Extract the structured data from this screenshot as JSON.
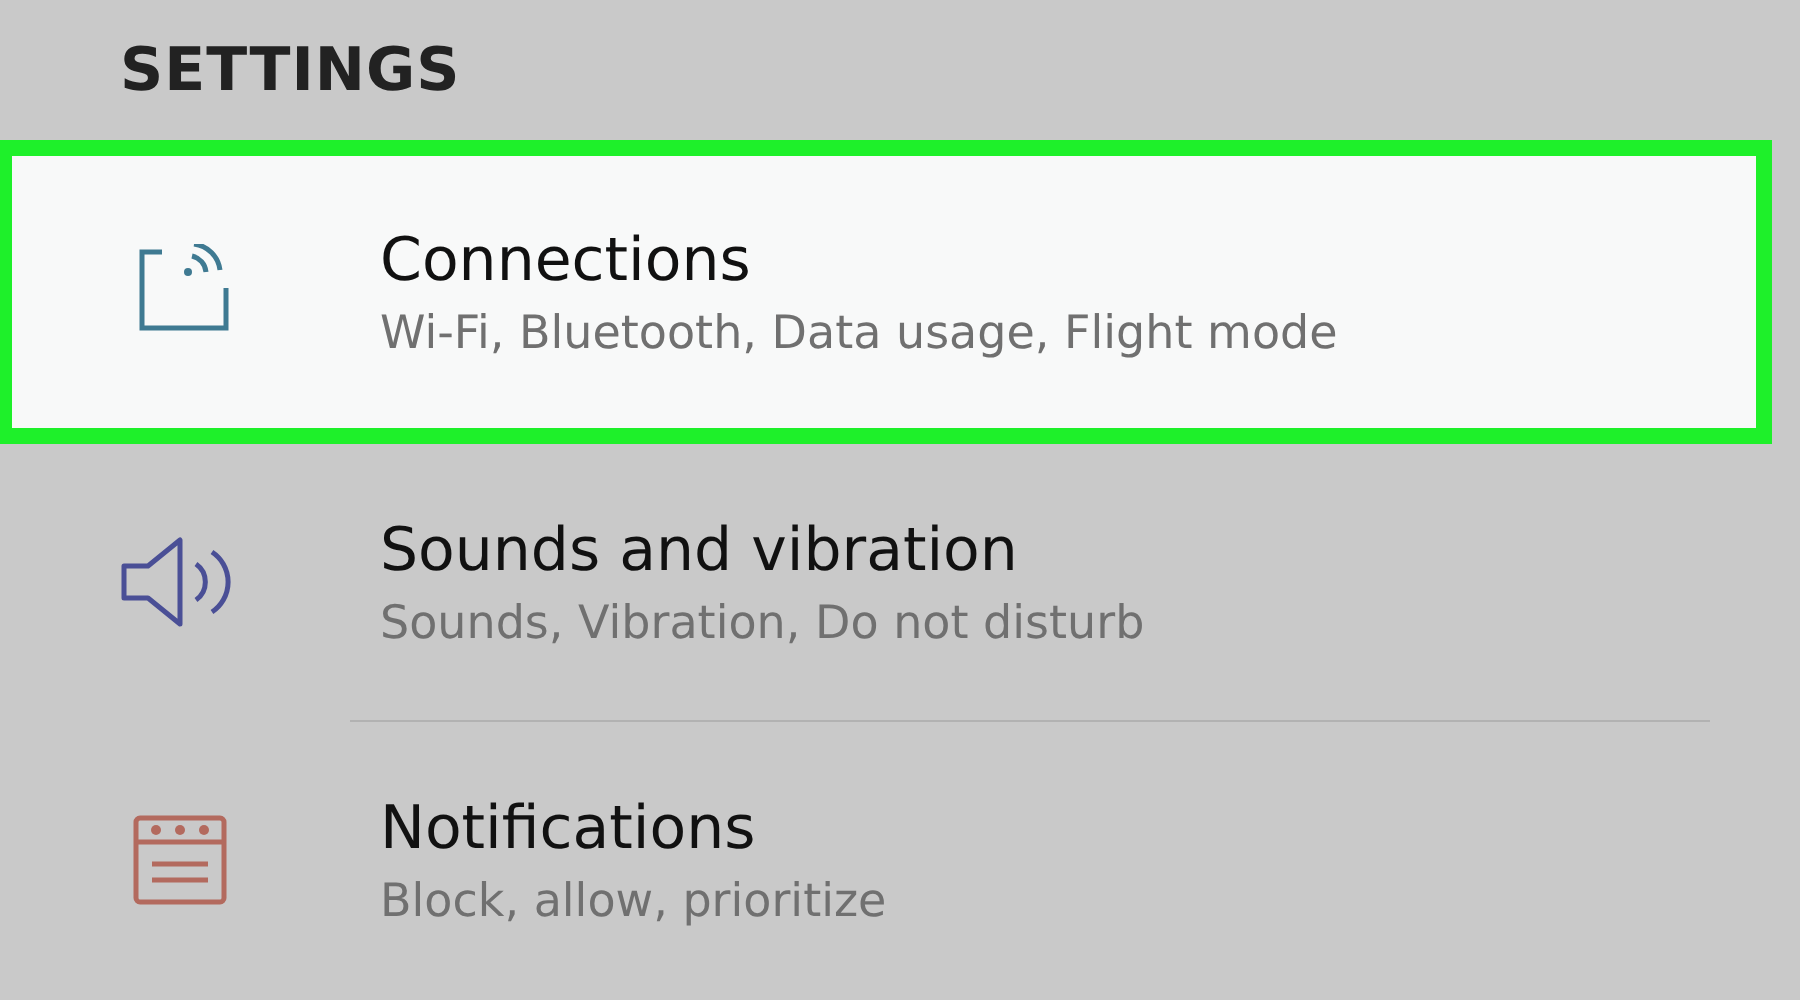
{
  "header": {
    "title": "SETTINGS"
  },
  "items": [
    {
      "kind": "connections",
      "title": "Connections",
      "subtitle": "Wi-Fi, Bluetooth, Data usage, Flight mode",
      "selected": true
    },
    {
      "kind": "sound",
      "title": "Sounds and vibration",
      "subtitle": "Sounds, Vibration, Do not disturb",
      "selected": false
    },
    {
      "kind": "notifications",
      "title": "Notifications",
      "subtitle": "Block, allow, prioritize",
      "selected": false
    }
  ]
}
